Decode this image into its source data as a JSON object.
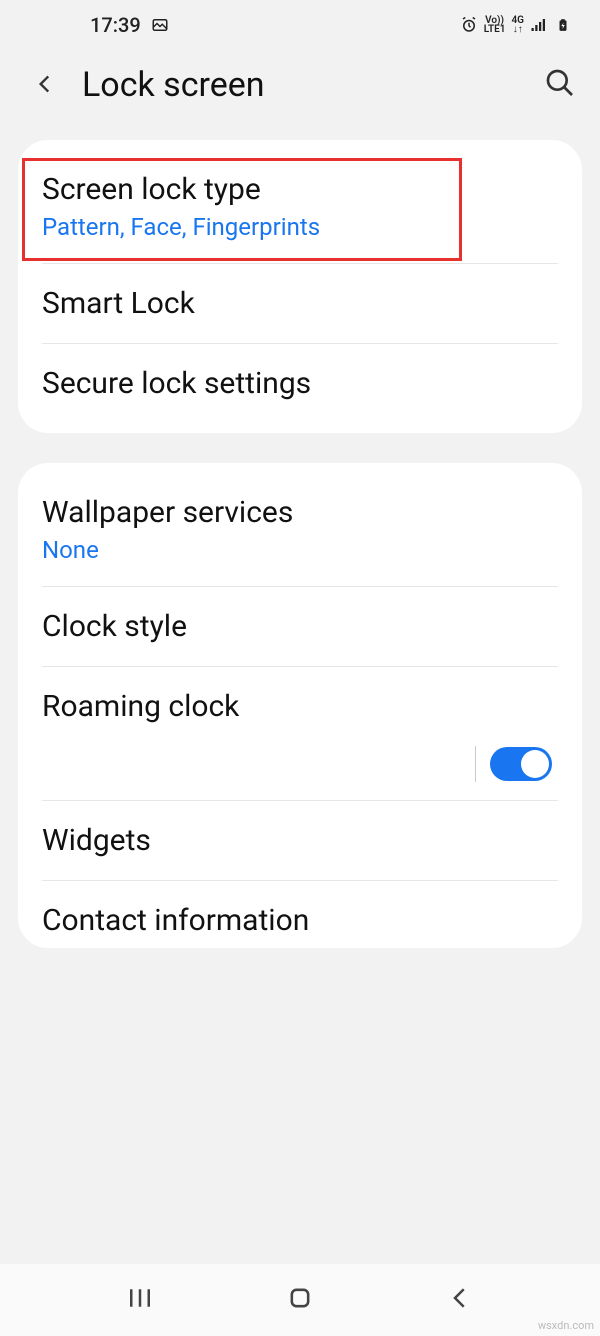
{
  "status": {
    "time": "17:39",
    "lte_label": "LTE1",
    "volte_label": "Vo))",
    "network": "4G"
  },
  "header": {
    "title": "Lock screen"
  },
  "group1": {
    "screen_lock": {
      "title": "Screen lock type",
      "sub": "Pattern, Face, Fingerprints"
    },
    "smart_lock": {
      "title": "Smart Lock"
    },
    "secure_lock": {
      "title": "Secure lock settings"
    }
  },
  "group2": {
    "wallpaper": {
      "title": "Wallpaper services",
      "sub": "None"
    },
    "clock_style": {
      "title": "Clock style"
    },
    "roaming_clock": {
      "title": "Roaming clock",
      "toggle": true
    },
    "widgets": {
      "title": "Widgets"
    },
    "contact_info": {
      "title": "Contact information"
    }
  },
  "watermark": "wsxdn.com"
}
